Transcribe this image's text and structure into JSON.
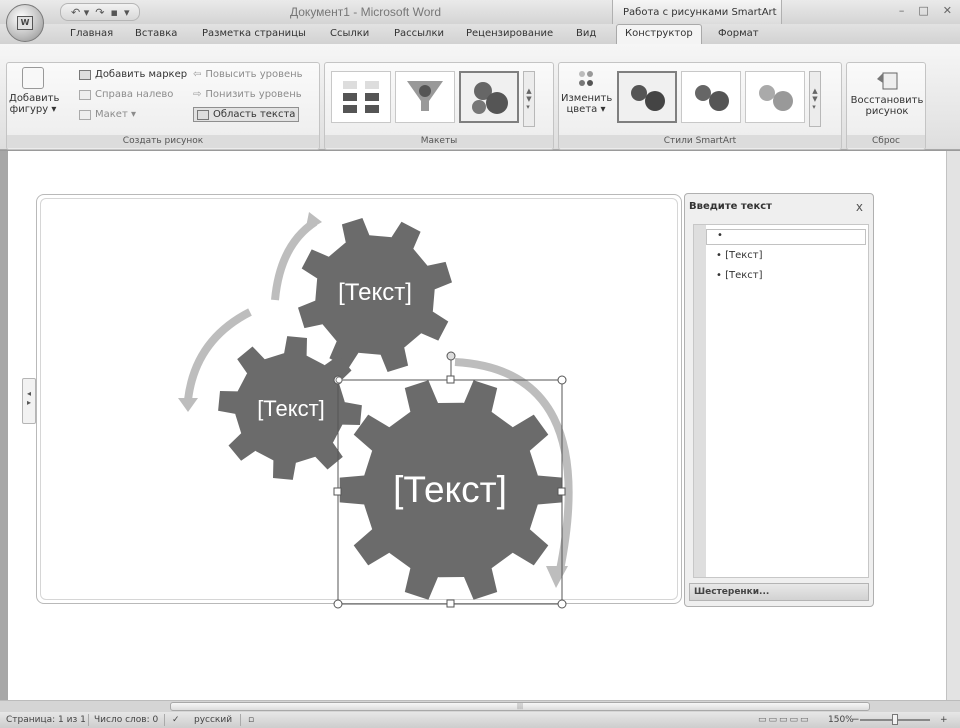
{
  "title_bar": {
    "document_title": "Документ1 - Microsoft Word",
    "context_group": "Работа с рисунками SmartArt",
    "minimize": "–",
    "maximize": "□",
    "close": "✕"
  },
  "office_button": {
    "logo": "W"
  },
  "quick_access": {
    "undo": "↶ ▾",
    "redo": "↷",
    "save": "▪",
    "customize": "▾"
  },
  "tabs": [
    "Главная",
    "Вставка",
    "Разметка страницы",
    "Ссылки",
    "Рассылки",
    "Рецензирование",
    "Вид",
    "Конструктор",
    "Формат"
  ],
  "ribbon": {
    "create_group": {
      "label": "Создать рисунок",
      "add_shape": "Добавить фигуру ▾",
      "add_bullet": "Добавить маркер",
      "right_to_left": "Справа налево",
      "layout": "Макет ▾",
      "promote": "Повысить уровень",
      "demote": "Понизить уровень",
      "text_pane": "Область текста"
    },
    "layouts_group": {
      "label": "Макеты"
    },
    "styles_group": {
      "label": "Стили SmartArt",
      "change_colors": "Изменить цвета ▾"
    },
    "reset_group": {
      "label": "Сброс",
      "reset_graphic": "Восстановить рисунок"
    }
  },
  "smartart": {
    "gear_large": "[Текст]",
    "gear_medium": "[Текст]",
    "gear_small": "[Текст]"
  },
  "text_pane": {
    "title": "Введите текст",
    "close": "x",
    "items": [
      "•",
      "[Текст]",
      "[Текст]"
    ],
    "footer": "Шестеренки..."
  },
  "status_bar": {
    "page": "Страница: 1 из 1",
    "word_count": "Число слов: 0",
    "language": "русский",
    "zoom": "150%",
    "zoom_minus": "−",
    "zoom_plus": "+"
  },
  "colors": {
    "gear": "#6b6b6b",
    "arrow": "#bdbdbd",
    "page": "#ffffff"
  }
}
